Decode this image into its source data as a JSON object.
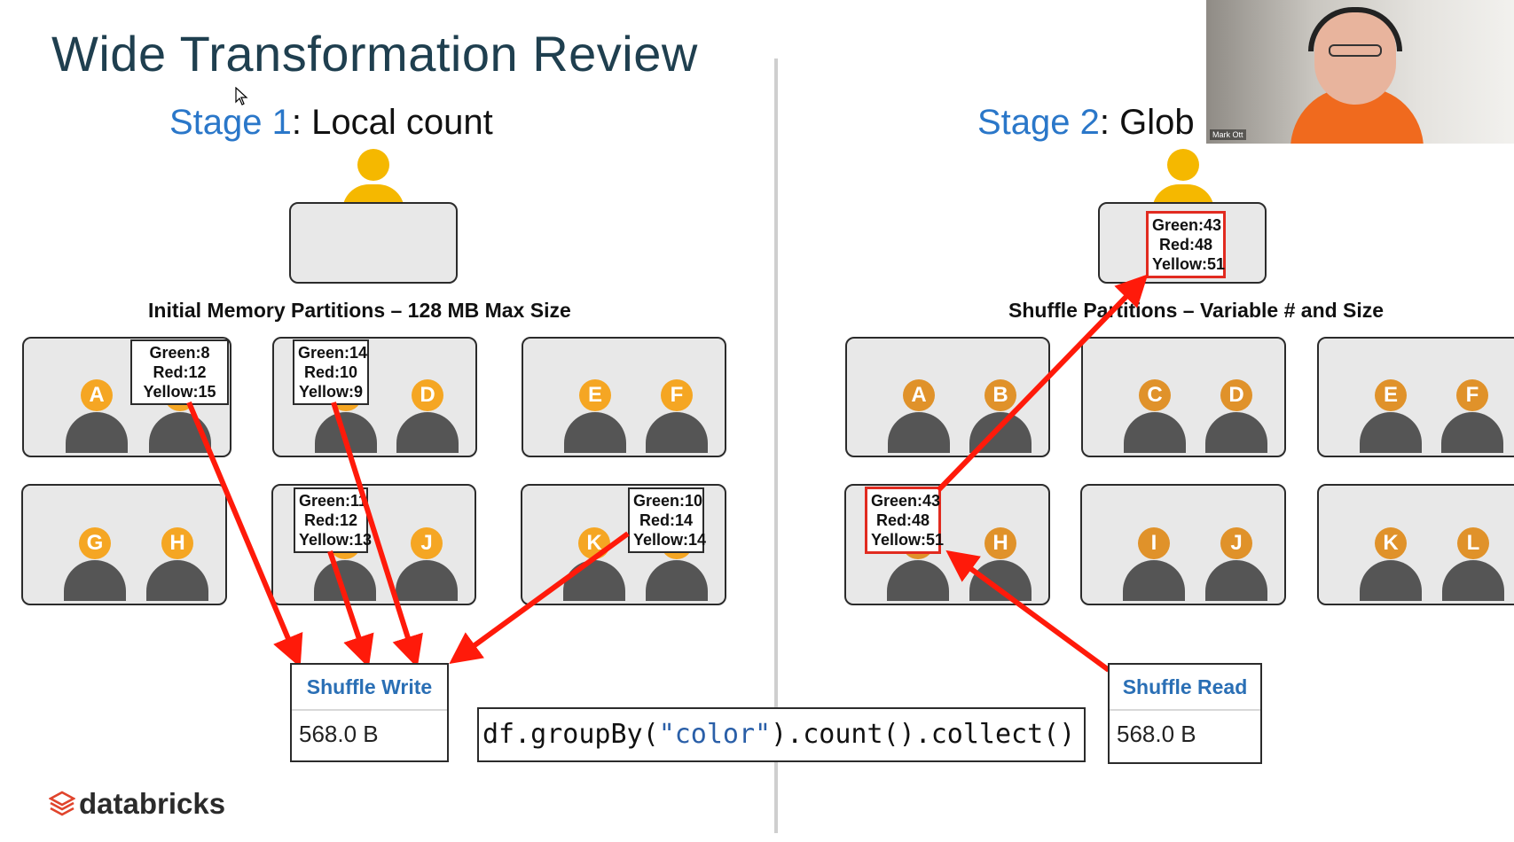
{
  "slide": {
    "title": "Wide Transformation Review",
    "stage1": {
      "label_prefix": "Stage 1",
      "label_rest": ": Local count"
    },
    "stage2": {
      "label_prefix": "Stage 2",
      "label_rest": ": Glob"
    },
    "stage1_partitions_label": "Initial Memory Partitions – 128 MB Max Size",
    "stage2_partitions_label": "Shuffle Partitions – Variable # and Size",
    "shuffle_write": {
      "label": "Shuffle Write",
      "value": "568.0 B"
    },
    "shuffle_read": {
      "label": "Shuffle Read",
      "value": "568.0 B"
    },
    "code": {
      "part1": "df.groupBy(",
      "string": "\"color\"",
      "part2": ").count().collect()"
    },
    "brand": "databricks",
    "webcam_name": "Mark Ott"
  },
  "stage1_counts": [
    {
      "green": "Green:8",
      "red": "Red:12",
      "yellow": "Yellow:15"
    },
    {
      "green": "Green:14",
      "red": "Red:10",
      "yellow": "Yellow:9"
    },
    {
      "green": "Green:11",
      "red": "Red:12",
      "yellow": "Yellow:13"
    },
    {
      "green": "Green:10",
      "red": "Red:14",
      "yellow": "Yellow:14"
    }
  ],
  "stage2_counts": {
    "partition": {
      "green": "Green:43",
      "red": "Red:48",
      "yellow": "Yellow:51"
    },
    "driver": {
      "green": "Green:43",
      "red": "Red:48",
      "yellow": "Yellow:51"
    }
  },
  "stage1_people": [
    [
      "A",
      "B"
    ],
    [
      "C",
      "D"
    ],
    [
      "E",
      "F"
    ],
    [
      "G",
      "H"
    ],
    [
      "I",
      "J"
    ],
    [
      "K",
      "L"
    ]
  ],
  "stage2_people": [
    [
      "A",
      "B"
    ],
    [
      "C",
      "D"
    ],
    [
      "E",
      "F"
    ],
    [
      "G",
      "H"
    ],
    [
      "I",
      "J"
    ],
    [
      "K",
      "L"
    ]
  ],
  "colors": {
    "stage1_person": "#f5a623",
    "stage2_person": "#e0922a",
    "driver_person": "#f5b800",
    "person_body": "#555555",
    "arrow": "#ff1a0a",
    "accent_blue": "#2a77c9"
  }
}
